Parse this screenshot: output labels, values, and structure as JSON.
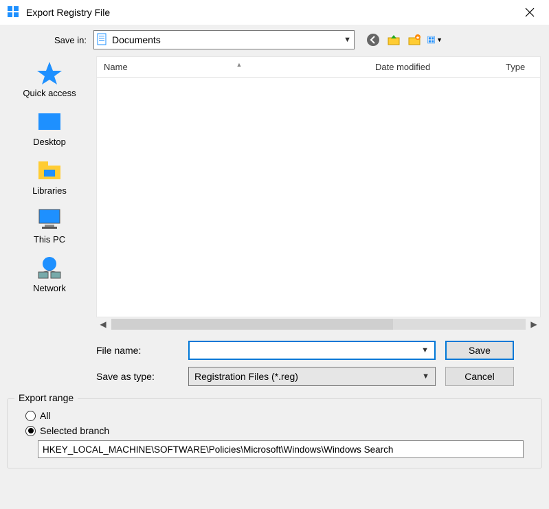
{
  "title": "Export Registry File",
  "savein": {
    "label": "Save in:",
    "value": "Documents"
  },
  "toolbar": {
    "back_icon": "back-icon",
    "up_icon": "up-folder-icon",
    "newfolder_icon": "new-folder-icon",
    "views_icon": "views-icon"
  },
  "places": [
    {
      "label": "Quick access",
      "icon": "quickaccess-icon"
    },
    {
      "label": "Desktop",
      "icon": "desktop-icon"
    },
    {
      "label": "Libraries",
      "icon": "libraries-icon"
    },
    {
      "label": "This PC",
      "icon": "thispc-icon"
    },
    {
      "label": "Network",
      "icon": "network-icon"
    }
  ],
  "columns": {
    "name": "Name",
    "date": "Date modified",
    "type": "Type"
  },
  "form": {
    "filename_label": "File name:",
    "filename_value": "",
    "filetype_label": "Save as type:",
    "filetype_value": "Registration Files (*.reg)"
  },
  "buttons": {
    "save": "Save",
    "cancel": "Cancel"
  },
  "export_range": {
    "legend": "Export range",
    "all_label": "All",
    "selected_label": "Selected branch",
    "selected_value": "HKEY_LOCAL_MACHINE\\SOFTWARE\\Policies\\Microsoft\\Windows\\Windows Search",
    "selected_checked": true
  }
}
